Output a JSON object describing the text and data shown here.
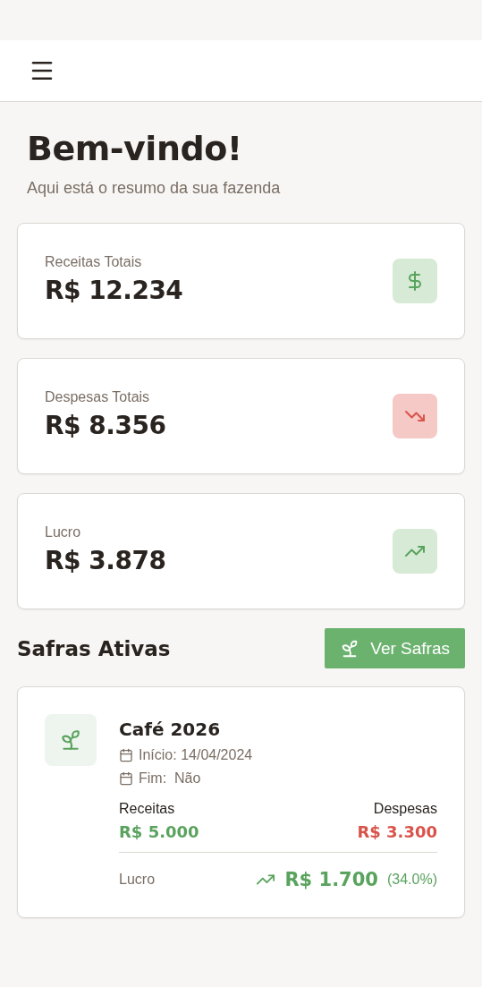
{
  "welcome": {
    "title": "Bem-vindo!",
    "subtitle": "Aqui está o resumo da sua fazenda"
  },
  "stats": [
    {
      "label": "Receitas Totais",
      "value": "R$ 12.234",
      "kind": "income"
    },
    {
      "label": "Despesas Totais",
      "value": "R$ 8.356",
      "kind": "expense"
    },
    {
      "label": "Lucro",
      "value": "R$ 3.878",
      "kind": "profit"
    }
  ],
  "section": {
    "title": "Safras Ativas",
    "button": "Ver Safras"
  },
  "crops": [
    {
      "name": "Café 2026",
      "start": "Início: 14/04/2024",
      "end": "Fim:  Não",
      "income_label": "Receitas",
      "income": "R$ 5.000",
      "expense_label": "Despesas",
      "expense": "R$ 3.300",
      "profit_label": "Lucro",
      "profit": "R$ 1.700",
      "profit_pct": "(34.0%)"
    }
  ]
}
